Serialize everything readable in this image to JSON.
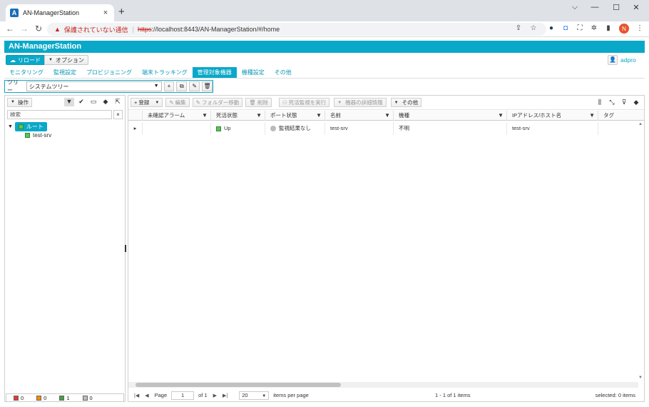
{
  "browser": {
    "tab_title": "AN-ManagerStation",
    "favicon_letter": "A",
    "tab_close": "×",
    "new_tab": "+",
    "win_chevron": "⌵",
    "win_minimize": "—",
    "win_maximize": "☐",
    "win_close": "✕",
    "security_warning": "保護されていない通信",
    "url_scheme": "https",
    "url_rest": "://localhost:8443/AN-ManagerStation/#/home",
    "profile_initial": "N"
  },
  "app": {
    "title": "AN-ManagerStation",
    "reload_label": "リロード",
    "options_label": "オプション",
    "user_name": "adpro"
  },
  "menu": {
    "items": [
      "モニタリング",
      "監視設定",
      "プロビジョニング",
      "端末トラッキング",
      "管理対象機器",
      "機種設定",
      "その他"
    ],
    "active_index": 4
  },
  "tree_toolbar": {
    "label": "ツリー",
    "selected": "システムツリー"
  },
  "left_panel": {
    "ops_label": "操作",
    "search_placeholder": "検索",
    "root_label": "ルート",
    "child_label": "test-srv",
    "counts": [
      {
        "value": "0",
        "color": "#e53935"
      },
      {
        "value": "0",
        "color": "#fb8c00"
      },
      {
        "value": "1",
        "color": "#43a047"
      },
      {
        "value": "0",
        "color": "#bdbdbd"
      }
    ]
  },
  "right_panel": {
    "toolbar": {
      "register": "登録",
      "edit": "編集",
      "move_folder": "フォルダー移動",
      "delete": "削除",
      "run_alive_check": "死活監視を実行",
      "device_details": "機器の詳細情報",
      "other": "その他"
    },
    "columns": [
      "未確認アラーム",
      "死活状態",
      "ポート状態",
      "名前",
      "機種",
      "IPアドレス/ホスト名",
      "タグ"
    ],
    "rows": [
      {
        "alarm": "",
        "alive": "Up",
        "port": "監視結果なし",
        "name": "test-srv",
        "model": "不明",
        "ip": "test-srv",
        "tag": ""
      }
    ],
    "pager": {
      "page_label": "Page",
      "page_value": "1",
      "of_label": "of 1",
      "per_page_value": "20",
      "per_page_label": "items per page",
      "range": "1 - 1 of 1 items",
      "selected": "selected: 0 items"
    }
  }
}
